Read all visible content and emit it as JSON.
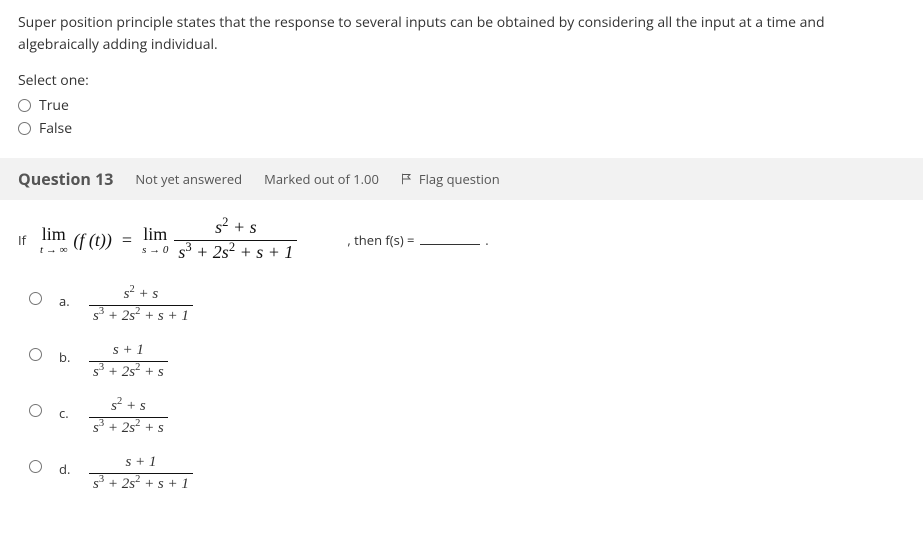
{
  "q12": {
    "text": "Super position principle states that the response to several inputs can be obtained by considering all the input at a time and algebraically adding individual.",
    "prompt": "Select one:",
    "opt_true": "True",
    "opt_false": "False"
  },
  "info": {
    "title": "Question 13",
    "status": "Not yet answered",
    "marks": "Marked out of 1.00",
    "flag": "Flag question"
  },
  "q13": {
    "if_word": "If",
    "lim1_word": "lim",
    "lim1_sub": "t → ∞",
    "lim1_fn": "(f (t))",
    "eq": "=",
    "lim2_word": "lim",
    "lim2_sub": "s → 0",
    "main_num": "s² + s",
    "main_den": "s³ + 2s² + s + 1",
    "then_text": ", then f(s) =",
    "period": ".",
    "a_letter": "a.",
    "a_num": "s² + s",
    "a_den": "s³ + 2s² + s + 1",
    "b_letter": "b.",
    "b_num": "s + 1",
    "b_den": "s³ + 2s² + s",
    "c_letter": "c.",
    "c_num": "s² + s",
    "c_den": "s³ + 2s² + s",
    "d_letter": "d.",
    "d_num": "s + 1",
    "d_den": "s³ + 2s² + s + 1"
  }
}
